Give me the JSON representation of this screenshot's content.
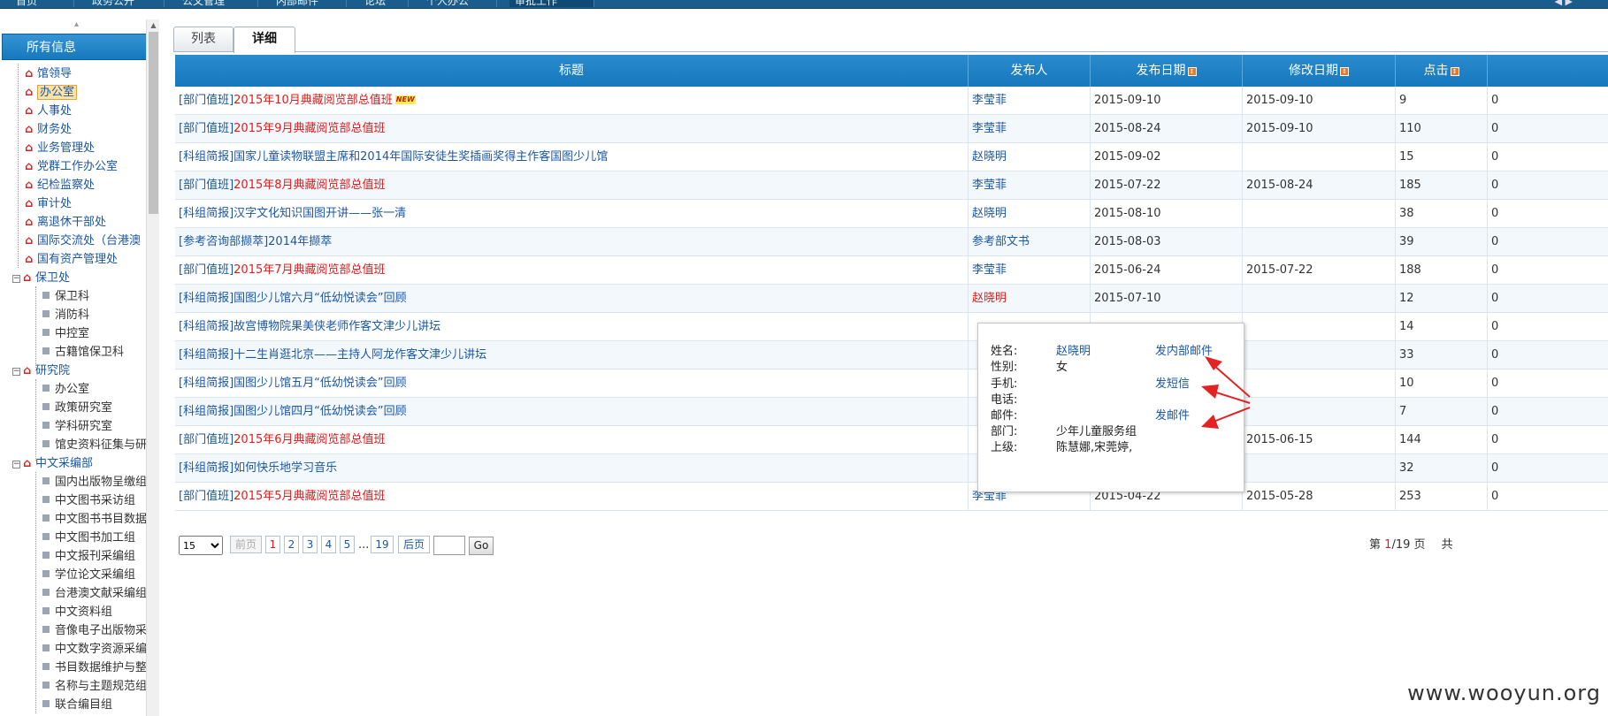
{
  "topnav": {
    "items": [
      "首页",
      "政务公开",
      "公文管理",
      "内部邮件",
      "论坛",
      "个人办公",
      "审批工作"
    ],
    "active_index": 6,
    "right_text": "◀ ▶"
  },
  "sidebar": {
    "header": "所有信息",
    "collapse_glyph": "▴",
    "nodes": [
      {
        "label": "馆领导",
        "type": "dept"
      },
      {
        "label": "办公室",
        "type": "dept",
        "selected": true
      },
      {
        "label": "人事处",
        "type": "dept"
      },
      {
        "label": "财务处",
        "type": "dept"
      },
      {
        "label": "业务管理处",
        "type": "dept"
      },
      {
        "label": "党群工作办公室",
        "type": "dept"
      },
      {
        "label": "纪检监察处",
        "type": "dept"
      },
      {
        "label": "审计处",
        "type": "dept"
      },
      {
        "label": "离退休干部处",
        "type": "dept"
      },
      {
        "label": "国际交流处（台港澳",
        "type": "dept"
      },
      {
        "label": "国有资产管理处",
        "type": "dept"
      },
      {
        "label": "保卫处",
        "type": "group"
      },
      {
        "label": "保卫科",
        "type": "child"
      },
      {
        "label": "消防科",
        "type": "child"
      },
      {
        "label": "中控室",
        "type": "child"
      },
      {
        "label": "古籍馆保卫科",
        "type": "child"
      },
      {
        "label": "研究院",
        "type": "group"
      },
      {
        "label": "办公室",
        "type": "child"
      },
      {
        "label": "政策研究室",
        "type": "child"
      },
      {
        "label": "学科研究室",
        "type": "child"
      },
      {
        "label": "馆史资料征集与研",
        "type": "child"
      },
      {
        "label": "中文采编部",
        "type": "group"
      },
      {
        "label": "国内出版物呈缴组",
        "type": "child"
      },
      {
        "label": "中文图书采访组",
        "type": "child"
      },
      {
        "label": "中文图书书目数据",
        "type": "child"
      },
      {
        "label": "中文图书加工组",
        "type": "child"
      },
      {
        "label": "中文报刊采编组",
        "type": "child"
      },
      {
        "label": "学位论文采编组",
        "type": "child"
      },
      {
        "label": "台港澳文献采编组",
        "type": "child"
      },
      {
        "label": "中文资料组",
        "type": "child"
      },
      {
        "label": "音像电子出版物采",
        "type": "child"
      },
      {
        "label": "中文数字资源采编",
        "type": "child"
      },
      {
        "label": "书目数据维护与整",
        "type": "child"
      },
      {
        "label": "名称与主题规范组",
        "type": "child"
      },
      {
        "label": "联合编目组",
        "type": "child"
      }
    ]
  },
  "tabs": [
    {
      "label": "列表"
    },
    {
      "label": "详细"
    }
  ],
  "grid": {
    "columns": [
      "标题",
      "发布人",
      "发布日期",
      "修改日期",
      "点击",
      ""
    ],
    "rows": [
      {
        "cat": "[部门值班]",
        "title": "2015年10月典藏阅览部总值班",
        "red": true,
        "new": true,
        "publisher": "李莹菲",
        "pub_red": false,
        "pub_date": "2015-09-10",
        "mod_date": "2015-09-10",
        "clicks": "9",
        "extra": "0"
      },
      {
        "cat": "[部门值班]",
        "title": "2015年9月典藏阅览部总值班",
        "red": true,
        "new": false,
        "publisher": "李莹菲",
        "pub_red": false,
        "pub_date": "2015-08-24",
        "mod_date": "2015-09-10",
        "clicks": "110",
        "extra": "0"
      },
      {
        "cat": "[科组简报]",
        "title": "国家儿童读物联盟主席和2014年国际安徒生奖插画奖得主作客国图少儿馆",
        "red": false,
        "new": false,
        "publisher": "赵晓明",
        "pub_red": false,
        "pub_date": "2015-09-02",
        "mod_date": "",
        "clicks": "15",
        "extra": "0"
      },
      {
        "cat": "[部门值班]",
        "title": "2015年8月典藏阅览部总值班",
        "red": true,
        "new": false,
        "publisher": "李莹菲",
        "pub_red": false,
        "pub_date": "2015-07-22",
        "mod_date": "2015-08-24",
        "clicks": "185",
        "extra": "0"
      },
      {
        "cat": "[科组简报]",
        "title": "汉字文化知识国图开讲——张一清",
        "red": false,
        "new": false,
        "publisher": "赵晓明",
        "pub_red": false,
        "pub_date": "2015-08-10",
        "mod_date": "",
        "clicks": "38",
        "extra": "0"
      },
      {
        "cat": "[参考咨询部撷萃]",
        "title": "2014年撷萃",
        "red": false,
        "new": false,
        "publisher": "参考部文书",
        "pub_red": false,
        "pub_date": "2015-08-03",
        "mod_date": "",
        "clicks": "39",
        "extra": "0"
      },
      {
        "cat": "[部门值班]",
        "title": "2015年7月典藏阅览部总值班",
        "red": true,
        "new": false,
        "publisher": "李莹菲",
        "pub_red": false,
        "pub_date": "2015-06-24",
        "mod_date": "2015-07-22",
        "clicks": "188",
        "extra": "0"
      },
      {
        "cat": "[科组简报]",
        "title": "国图少儿馆六月“低幼悦读会”回顾",
        "red": false,
        "new": false,
        "publisher": "赵晓明",
        "pub_red": true,
        "pub_date": "2015-07-10",
        "mod_date": "",
        "clicks": "12",
        "extra": "0"
      },
      {
        "cat": "[科组简报]",
        "title": "故宫博物院果美侠老师作客文津少儿讲坛",
        "red": false,
        "new": false,
        "publisher": "",
        "pub_red": false,
        "pub_date": "",
        "mod_date": "",
        "clicks": "14",
        "extra": "0"
      },
      {
        "cat": "[科组简报]",
        "title": "十二生肖逛北京——主持人阿龙作客文津少儿讲坛",
        "red": false,
        "new": false,
        "publisher": "",
        "pub_red": false,
        "pub_date": "",
        "mod_date": "",
        "clicks": "33",
        "extra": "0"
      },
      {
        "cat": "[科组简报]",
        "title": "国图少儿馆五月“低幼悦读会”回顾",
        "red": false,
        "new": false,
        "publisher": "",
        "pub_red": false,
        "pub_date": "",
        "mod_date": "",
        "clicks": "10",
        "extra": "0"
      },
      {
        "cat": "[科组简报]",
        "title": "国图少儿馆四月“低幼悦读会”回顾",
        "red": false,
        "new": false,
        "publisher": "",
        "pub_red": false,
        "pub_date": "",
        "mod_date": "",
        "clicks": "7",
        "extra": "0"
      },
      {
        "cat": "[部门值班]",
        "title": "2015年6月典藏阅览部总值班",
        "red": true,
        "new": false,
        "publisher": "",
        "pub_red": false,
        "pub_date": "",
        "mod_date": "2015-06-15",
        "clicks": "144",
        "extra": "0"
      },
      {
        "cat": "[科组简报]",
        "title": "如何快乐地学习音乐",
        "red": false,
        "new": false,
        "publisher": "",
        "pub_red": false,
        "pub_date": "",
        "mod_date": "",
        "clicks": "32",
        "extra": "0"
      },
      {
        "cat": "[部门值班]",
        "title": "2015年5月典藏阅览部总值班",
        "red": true,
        "new": false,
        "publisher": "李莹菲",
        "pub_red": false,
        "pub_date": "2015-04-22",
        "mod_date": "2015-05-28",
        "clicks": "253",
        "extra": "0"
      }
    ],
    "new_badge": "NEW",
    "sort_glyph": "↕"
  },
  "pager": {
    "page_size": "15",
    "prev": "前页",
    "pages": [
      "1",
      "2",
      "3",
      "4",
      "5"
    ],
    "ellipsis": "...",
    "last_page": "19",
    "next": "后页",
    "go": "Go",
    "page_prefix": "第",
    "current": "1",
    "total": "/19",
    "page_suffix": "页",
    "total_prefix": "共"
  },
  "popup": {
    "name_label": "姓名:",
    "name": "赵晓明",
    "gender_label": "性别:",
    "gender": "女",
    "mobile_label": "手机:",
    "phone_label": "电话:",
    "email_label": "邮件:",
    "dept_label": "部门:",
    "dept": "少年儿童服务组",
    "superior_label": "上级:",
    "superior": "陈慧娜,宋莞婷,",
    "link_internal_mail": "发内部邮件",
    "link_sms": "发短信",
    "link_email": "发邮件"
  },
  "watermark": "www.wooyun.org",
  "colors": {
    "header_blue": "#1677bd",
    "link_blue": "#1b57a5",
    "alert_red": "#e01b1b",
    "annotation_red": "#e52222"
  }
}
